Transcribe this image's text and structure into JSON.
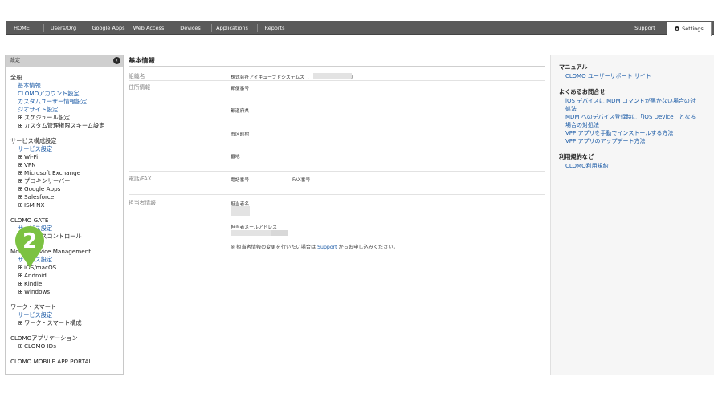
{
  "nav": {
    "tabs": [
      "HOME",
      "Users/Org",
      "Google Apps",
      "Web Access",
      "Devices",
      "Applications",
      "Reports"
    ],
    "support": "Support",
    "settings": "Settings"
  },
  "sidebar": {
    "header": "設定",
    "groups": [
      {
        "title": "全般",
        "items": [
          {
            "label": "基本情報",
            "type": "link"
          },
          {
            "label": "CLOMOアカウント設定",
            "type": "link"
          },
          {
            "label": "カスタムユーザー情報設定",
            "type": "link"
          },
          {
            "label": "ジオサイト設定",
            "type": "link"
          },
          {
            "label": "スケジュール設定",
            "type": "expand"
          },
          {
            "label": "カスタム管理権限スキーム設定",
            "type": "expand"
          }
        ]
      },
      {
        "title": "サービス構成設定",
        "items": [
          {
            "label": "サービス設定",
            "type": "link"
          },
          {
            "label": "Wi-Fi",
            "type": "expand"
          },
          {
            "label": "VPN",
            "type": "expand"
          },
          {
            "label": "Microsoft Exchange",
            "type": "expand"
          },
          {
            "label": "プロキシサーバー",
            "type": "expand"
          },
          {
            "label": "Google Apps",
            "type": "expand"
          },
          {
            "label": "Salesforce",
            "type": "expand"
          },
          {
            "label": "ISM NX",
            "type": "expand"
          }
        ]
      },
      {
        "title": "CLOMO GATE",
        "items": [
          {
            "label": "サービス設定",
            "type": "link"
          },
          {
            "label": "アクセスコントロール",
            "type": "expand"
          }
        ]
      },
      {
        "title": "Mobile Device Management",
        "items": [
          {
            "label": "サービス設定",
            "type": "link"
          },
          {
            "label": "iOS/macOS",
            "type": "expand"
          },
          {
            "label": "Android",
            "type": "expand"
          },
          {
            "label": "Kindle",
            "type": "expand"
          },
          {
            "label": "Windows",
            "type": "expand"
          }
        ]
      },
      {
        "title": "ワーク・スマート",
        "items": [
          {
            "label": "サービス設定",
            "type": "link"
          },
          {
            "label": "ワーク・スマート構成",
            "type": "expand"
          }
        ]
      },
      {
        "title": "CLOMOアプリケーション",
        "items": [
          {
            "label": "CLOMO IDs",
            "type": "expand"
          }
        ]
      },
      {
        "title": "CLOMO MOBILE APP PORTAL",
        "items": []
      }
    ]
  },
  "marker": {
    "number": "2",
    "color": "#7cc242"
  },
  "main": {
    "title": "基本情報",
    "org_label": "組織名",
    "org_value": "株式会社アイキューブドシステムズ（",
    "org_close": "）",
    "address_label": "住所情報",
    "postal": "郵便番号",
    "prefecture": "都道府県",
    "city": "市区町村",
    "street": "番地",
    "phone_label": "電話/FAX",
    "phone": "電話番号",
    "fax": "FAX番号",
    "contact_label": "担当者情報",
    "contact_name": "担当者名",
    "contact_email": "担当者メールアドレス",
    "note_prefix": "※ 担当者情報の変更を行いたい場合は ",
    "note_link": "Support",
    "note_suffix": " からお申し込みください。"
  },
  "right": {
    "manual_title": "マニュアル",
    "manual_link": "CLOMO ユーザーサポート サイト",
    "faq_title": "よくあるお問合せ",
    "faq_links": [
      "iOS デバイスに MDM コマンドが届かない場合の対",
      "処法",
      "MDM へのデバイス登録時に「iOS Device」となる",
      "場合の対処法",
      "VPP アプリを手動でインストールする方法",
      "VPP アプリのアップデート方法"
    ],
    "terms_title": "利用規約など",
    "terms_link": "CLOMO利用規約"
  }
}
